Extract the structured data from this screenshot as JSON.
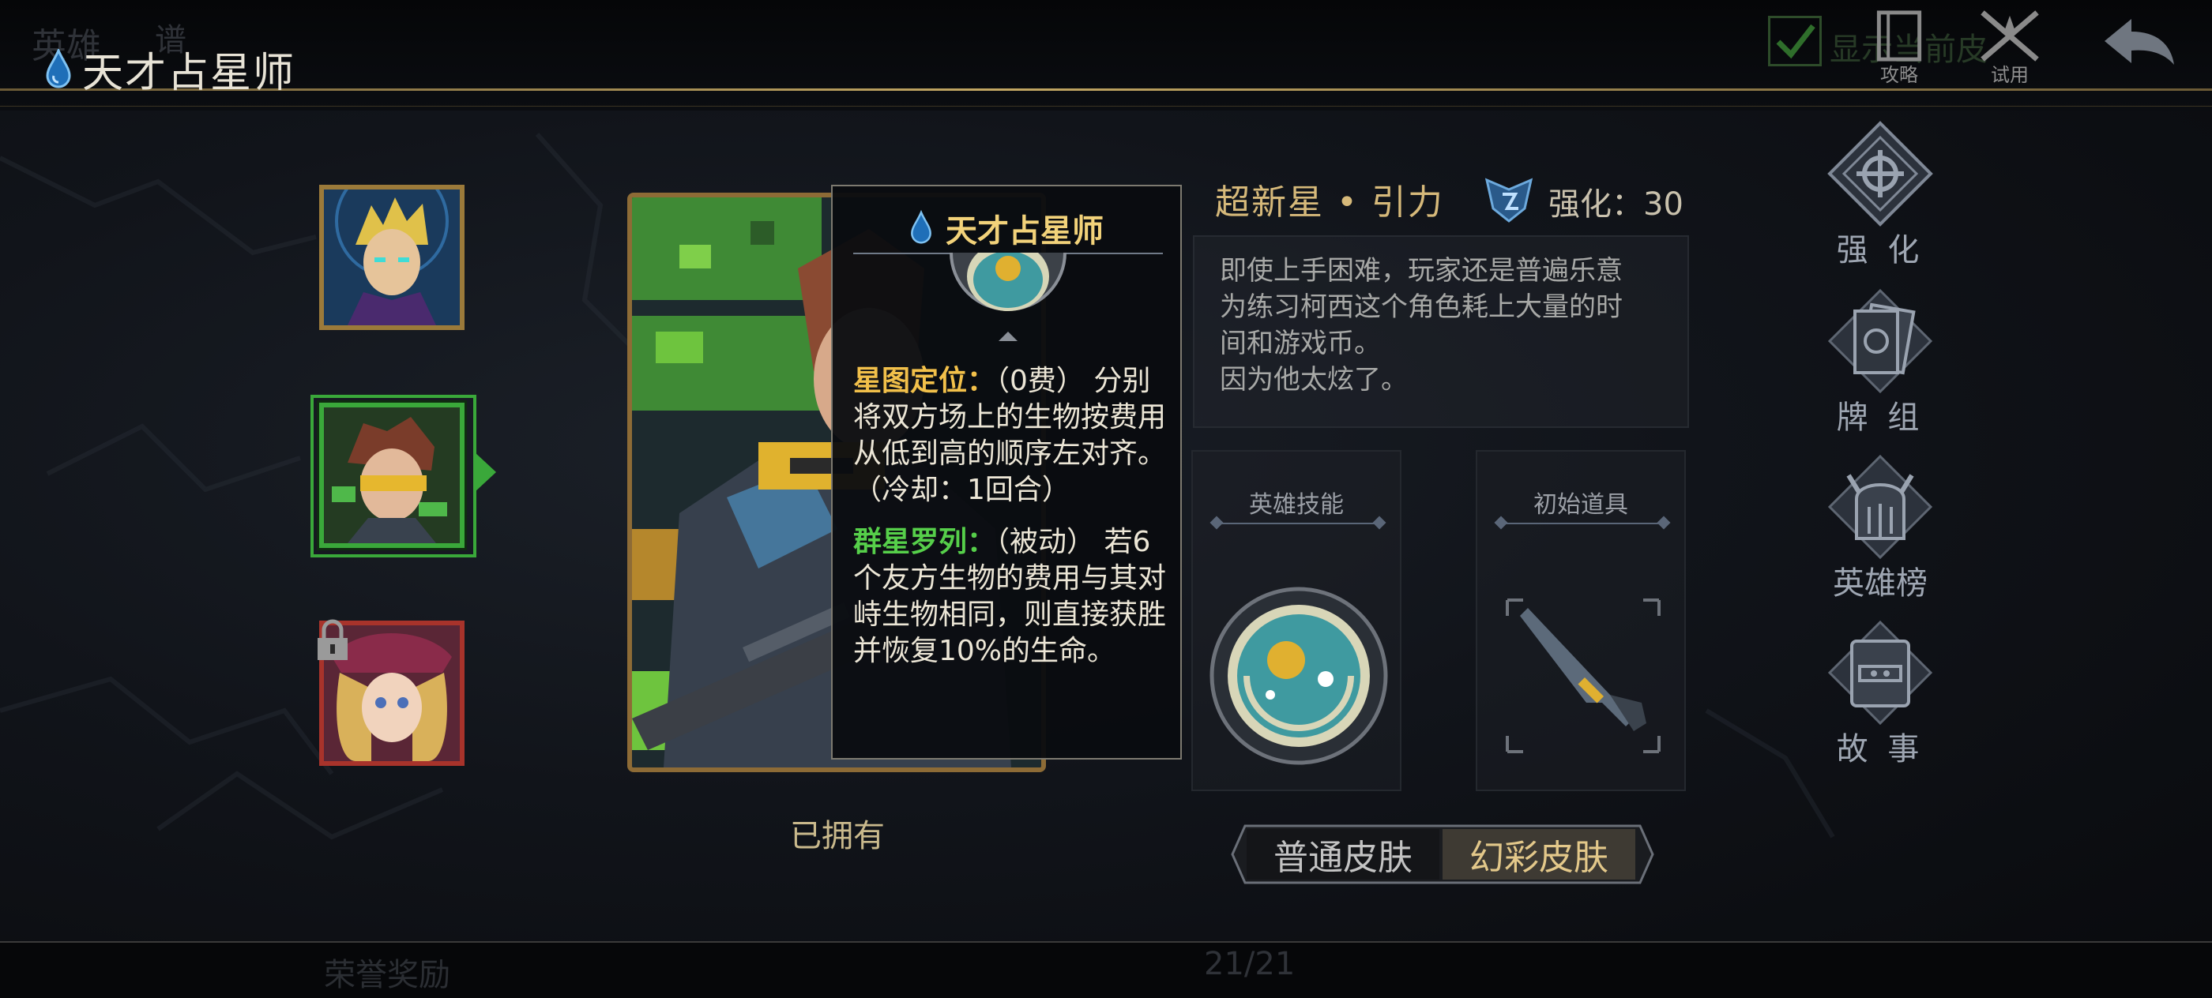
{
  "header": {
    "ghost_title": "英雄",
    "ghost_sub": "谱",
    "title": "天才占星师",
    "show_current_label": "显示当前皮",
    "guide_label": "攻略",
    "trial_label": "试用"
  },
  "hero_list": [
    {
      "name": "hero-1",
      "state": "normal"
    },
    {
      "name": "hero-2",
      "state": "selected"
    },
    {
      "name": "hero-3",
      "state": "locked"
    }
  ],
  "card": {
    "owned_label": "已拥有"
  },
  "tooltip": {
    "title": "天才占星师",
    "skill1_name": "星图定位：",
    "skill1_cost": "（0费）",
    "skill1_desc": "分别将双方场上的生物按费用从低到高的顺序左对齐。（冷却：1回合）",
    "skill2_name": "群星罗列：",
    "skill2_cost": "（被动）",
    "skill2_desc": "若6个友方生物的费用与其对峙生物相同，则直接获胜并恢复10%的生命。"
  },
  "info": {
    "skin_name": "超新星 • 引力",
    "enhance_label": "强化：30",
    "description": "即使上手困难，玩家还是普遍乐意\n为练习柯西这个角色耗上大量的时\n间和游戏币。\n因为他太炫了。",
    "hero_skill_label": "英雄技能",
    "start_item_label": "初始道具",
    "skin_normal": "普通皮肤",
    "skin_illusion": "幻彩皮肤"
  },
  "nav": {
    "enhance": "强 化",
    "deck": "牌 组",
    "ranking": "英雄榜",
    "story": "故 事"
  },
  "footer": {
    "honor_label": "荣誉奖励",
    "pager": "21/21"
  },
  "colors": {
    "gold": "#c3a763",
    "green": "#3aa83a",
    "locked_red": "#a8332b"
  }
}
